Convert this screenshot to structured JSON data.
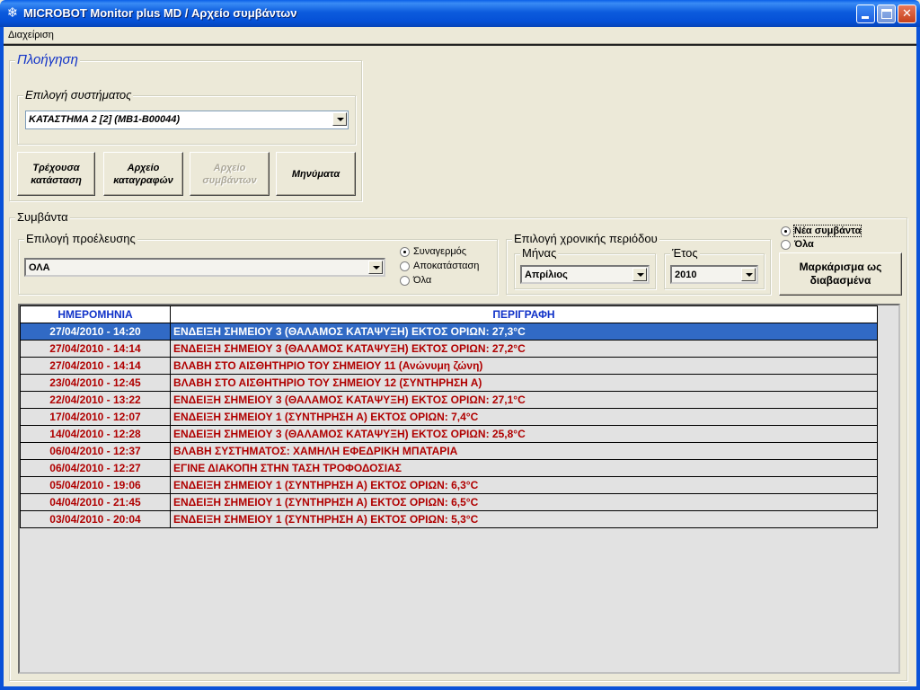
{
  "window": {
    "title": "MICROBOT Monitor plus MD / Αρχείο συμβάντων",
    "app_icon": "snowflake-icon",
    "controls": [
      "minimize-icon",
      "maximize-icon",
      "close-icon"
    ]
  },
  "menu": {
    "items": [
      "Διαχείριση"
    ]
  },
  "navigation": {
    "legend": "Πλοήγηση",
    "system_select": {
      "legend": "Επιλογή συστήματος",
      "value": "ΚΑΤΑΣΤΗΜΑ 2 [2] (MB1-B00044)"
    },
    "buttons": [
      {
        "line1": "Τρέχουσα",
        "line2": "κατάσταση",
        "enabled": true
      },
      {
        "line1": "Αρχείο",
        "line2": "καταγραφών",
        "enabled": true
      },
      {
        "line1": "Αρχείο",
        "line2": "συμβάντων",
        "enabled": false
      },
      {
        "line1": "Μηνύματα",
        "line2": "",
        "enabled": true
      }
    ]
  },
  "events": {
    "legend": "Συμβάντα",
    "source": {
      "legend": "Επιλογή προέλευσης",
      "value": "ΟΛΑ",
      "radios": [
        {
          "label": "Συναγερμός",
          "checked": true
        },
        {
          "label": "Αποκατάσταση",
          "checked": false
        },
        {
          "label": "Όλα",
          "checked": false
        }
      ]
    },
    "period": {
      "legend": "Επιλογή χρονικής περιόδου",
      "month": {
        "legend": "Μήνας",
        "value": "Απρίλιος"
      },
      "year": {
        "legend": "Έτος",
        "value": "2010"
      }
    },
    "filter_radios": [
      {
        "label": "Νέα συμβάντα",
        "checked": true
      },
      {
        "label": "Όλα",
        "checked": false
      }
    ],
    "mark_read_button": {
      "line1": "Μαρκάρισμα ως",
      "line2": "διαβασμένα"
    }
  },
  "table": {
    "columns": [
      "ΗΜΕΡΟΜΗΝΙΑ",
      "ΠΕΡΙΓΡΑΦΗ"
    ],
    "selected_index": 0,
    "rows": [
      {
        "date": "27/04/2010 - 14:20",
        "desc": "ΕΝΔΕΙΞΗ ΣΗΜΕΙΟΥ 3 (ΘΑΛΑΜΟΣ ΚΑΤΑΨΥΞΗ) ΕΚΤΟΣ ΟΡΙΩΝ: 27,3°C"
      },
      {
        "date": "27/04/2010 - 14:14",
        "desc": "ΕΝΔΕΙΞΗ ΣΗΜΕΙΟΥ 3 (ΘΑΛΑΜΟΣ ΚΑΤΑΨΥΞΗ) ΕΚΤΟΣ ΟΡΙΩΝ: 27,2°C"
      },
      {
        "date": "27/04/2010 - 14:14",
        "desc": "ΒΛΑΒΗ ΣΤΟ ΑΙΣΘΗΤΗΡΙΟ ΤΟΥ ΣΗΜΕΙΟΥ 11 (Ανώνυμη ζώνη)"
      },
      {
        "date": "23/04/2010 - 12:45",
        "desc": "ΒΛΑΒΗ ΣΤΟ ΑΙΣΘΗΤΗΡΙΟ ΤΟΥ ΣΗΜΕΙΟΥ 12 (ΣΥΝΤΗΡΗΣΗ Α)"
      },
      {
        "date": "22/04/2010 - 13:22",
        "desc": "ΕΝΔΕΙΞΗ ΣΗΜΕΙΟΥ 3 (ΘΑΛΑΜΟΣ ΚΑΤΑΨΥΞΗ) ΕΚΤΟΣ ΟΡΙΩΝ: 27,1°C"
      },
      {
        "date": "17/04/2010 - 12:07",
        "desc": "ΕΝΔΕΙΞΗ ΣΗΜΕΙΟΥ 1 (ΣΥΝΤΗΡΗΣΗ Α) ΕΚΤΟΣ ΟΡΙΩΝ: 7,4°C"
      },
      {
        "date": "14/04/2010 - 12:28",
        "desc": "ΕΝΔΕΙΞΗ ΣΗΜΕΙΟΥ 3 (ΘΑΛΑΜΟΣ ΚΑΤΑΨΥΞΗ) ΕΚΤΟΣ ΟΡΙΩΝ: 25,8°C"
      },
      {
        "date": "06/04/2010 - 12:37",
        "desc": "ΒΛΑΒΗ ΣΥΣΤΗΜΑΤΟΣ: ΧΑΜΗΛΗ ΕΦΕΔΡΙΚΗ ΜΠΑΤΑΡΙΑ"
      },
      {
        "date": "06/04/2010 - 12:27",
        "desc": "ΕΓΙΝΕ ΔΙΑΚΟΠΗ ΣΤΗΝ ΤΑΣΗ ΤΡΟΦΟΔΟΣΙΑΣ"
      },
      {
        "date": "05/04/2010 - 19:06",
        "desc": "ΕΝΔΕΙΞΗ ΣΗΜΕΙΟΥ 1 (ΣΥΝΤΗΡΗΣΗ Α) ΕΚΤΟΣ ΟΡΙΩΝ: 6,3°C"
      },
      {
        "date": "04/04/2010 - 21:45",
        "desc": "ΕΝΔΕΙΞΗ ΣΗΜΕΙΟΥ 1 (ΣΥΝΤΗΡΗΣΗ Α) ΕΚΤΟΣ ΟΡΙΩΝ: 6,5°C"
      },
      {
        "date": "03/04/2010 - 20:04",
        "desc": "ΕΝΔΕΙΞΗ ΣΗΜΕΙΟΥ 1 (ΣΥΝΤΗΡΗΣΗ Α) ΕΚΤΟΣ ΟΡΙΩΝ: 5,3°C"
      }
    ]
  },
  "colors": {
    "titlebar": "#0a5fe8",
    "window_bg": "#ece9d8",
    "nav_legend": "#1032c8",
    "row_text": "#b00000",
    "selected_row": "#316ac5",
    "header_text": "#1032c8"
  }
}
